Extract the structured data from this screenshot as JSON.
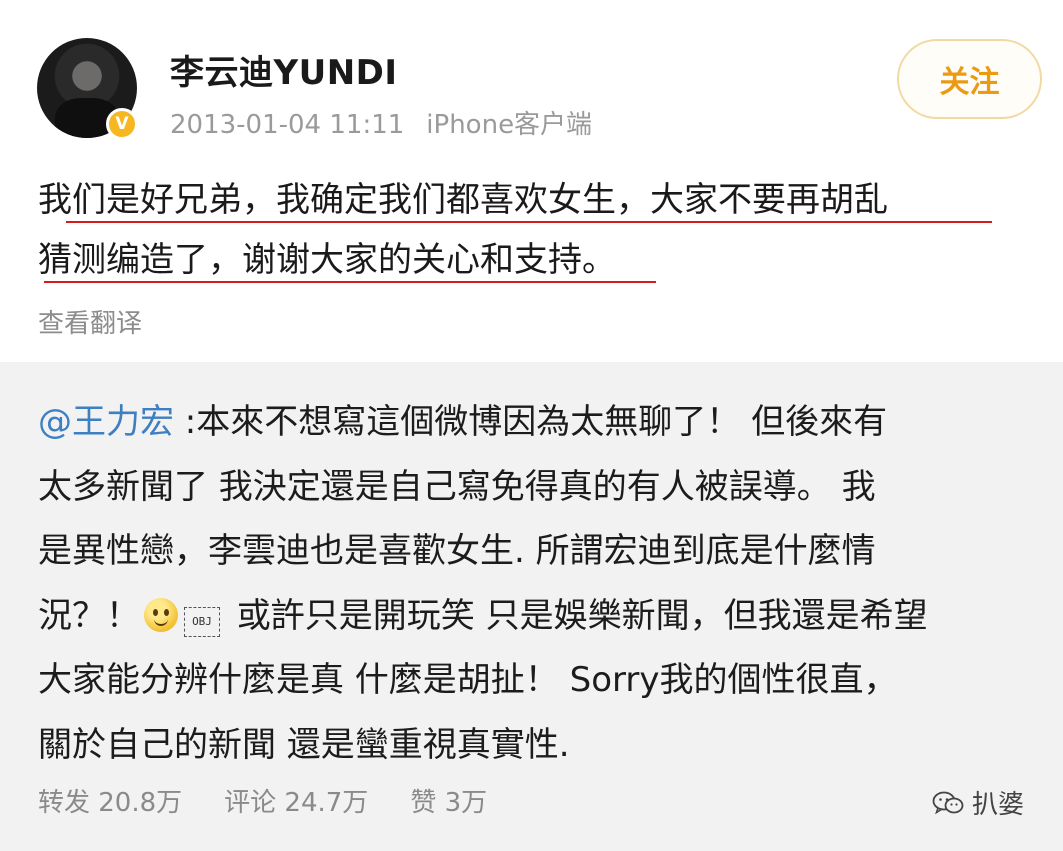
{
  "post": {
    "username": "李云迪YUNDI",
    "timestamp": "2013-01-04 11:11",
    "source": "iPhone客户端",
    "follow_label": "关注",
    "verified_badge": "V",
    "text_line1": "我们是好兄弟，我确定我们都喜欢女生，大家不要再胡乱",
    "text_line2": "猜测编造了，谢谢大家的关心和支持。",
    "translate_label": "查看翻译"
  },
  "repost": {
    "mention": "@王力宏",
    "lines": [
      " :本來不想寫這個微博因為太無聊了！ 但後來有",
      "太多新聞了 我決定還是自己寫免得真的有人被誤導。 我",
      "是異性戀，李雲迪也是喜歡女生. 所謂宏迪到底是什麼情",
      " 或許只是開玩笑 只是娛樂新聞，但我還是希望",
      "大家能分辨什麼是真 什麼是胡扯！ Sorry我的個性很直，",
      "關於自己的新聞 還是蠻重視真實性."
    ],
    "line4_prefix": "況？！",
    "obj_label": "OBJ",
    "stats": {
      "repost": "转发 20.8万",
      "comment": "评论 24.7万",
      "like": "赞 3万"
    }
  },
  "watermark": "扒婆",
  "colors": {
    "mention": "#3d7fc1",
    "follow_text": "#eb9a14",
    "underline": "#d41c1c",
    "badge": "#f6b721"
  }
}
